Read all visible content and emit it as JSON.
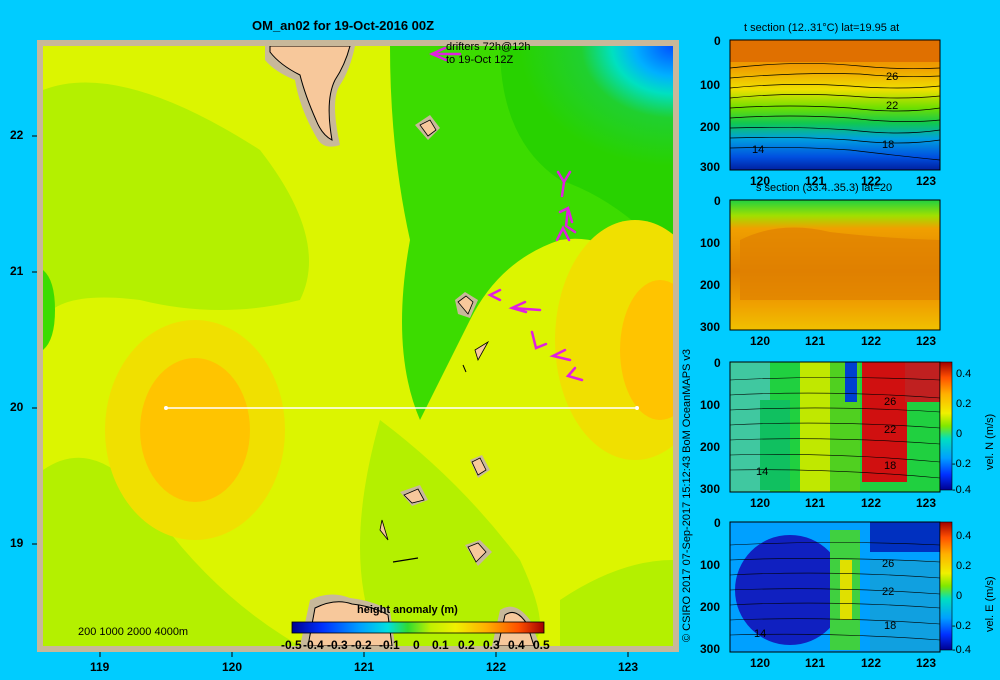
{
  "map": {
    "title": "OM_an02 for 19-Oct-2016 00Z",
    "drifters_note_line1": "drifters 72h@12h",
    "drifters_note_line2": "to 19-Oct 12Z",
    "y_ticks": [
      "22",
      "21",
      "20",
      "19"
    ],
    "x_ticks": [
      "119",
      "120",
      "121",
      "122",
      "123"
    ],
    "depth_legend": "200  1000  2000  4000m",
    "colorbar": {
      "label": "height anomaly (m)",
      "ticks": [
        "-0.5",
        "-0.4",
        "-0.3",
        "-0.2",
        "-0.1",
        "0",
        "0.1",
        "0.2",
        "0.3",
        "0.4",
        "0.5"
      ]
    },
    "section_line_lat": 20
  },
  "credit": "© CSIRO 2017   07-Sep-2017 15:12:43 BoM OceanMAPS v3",
  "panels": [
    {
      "title": "t section (12..31°C) lat=19.95 at",
      "y_ticks": [
        "0",
        "100",
        "200",
        "300"
      ],
      "x_ticks": [
        "120",
        "121",
        "122",
        "123"
      ],
      "contour_labels": [
        "26",
        "22",
        "18",
        "14"
      ]
    },
    {
      "title": "s section (33.4..35.3) lat=20",
      "y_ticks": [
        "0",
        "100",
        "200",
        "300"
      ],
      "x_ticks": [
        "120",
        "121",
        "122",
        "123"
      ]
    },
    {
      "title": "",
      "y_ticks": [
        "0",
        "100",
        "200",
        "300"
      ],
      "x_ticks": [
        "120",
        "121",
        "122",
        "123"
      ],
      "contour_labels": [
        "26",
        "22",
        "18",
        "14"
      ],
      "colorbar_label": "vel. N (m/s)",
      "colorbar_ticks": [
        "0.4",
        "0.2",
        "0",
        "-0.2",
        "-0.4"
      ]
    },
    {
      "title": "",
      "y_ticks": [
        "0",
        "100",
        "200",
        "300"
      ],
      "x_ticks": [
        "120",
        "121",
        "122",
        "123"
      ],
      "contour_labels": [
        "26",
        "22",
        "18",
        "14"
      ],
      "colorbar_label": "vel. E (m/s)",
      "colorbar_ticks": [
        "0.4",
        "0.2",
        "0",
        "-0.2",
        "-0.4"
      ]
    }
  ],
  "colors": {
    "background": "#00ccff",
    "frame": "#c8b89a",
    "land": "#f7c89b",
    "field_low": "#b4f000",
    "field_mid": "#dcf500",
    "field_green": "#32dc00",
    "field_high": "#ffc400",
    "drifter": "#e020e0",
    "section_line": "#ffffff"
  }
}
